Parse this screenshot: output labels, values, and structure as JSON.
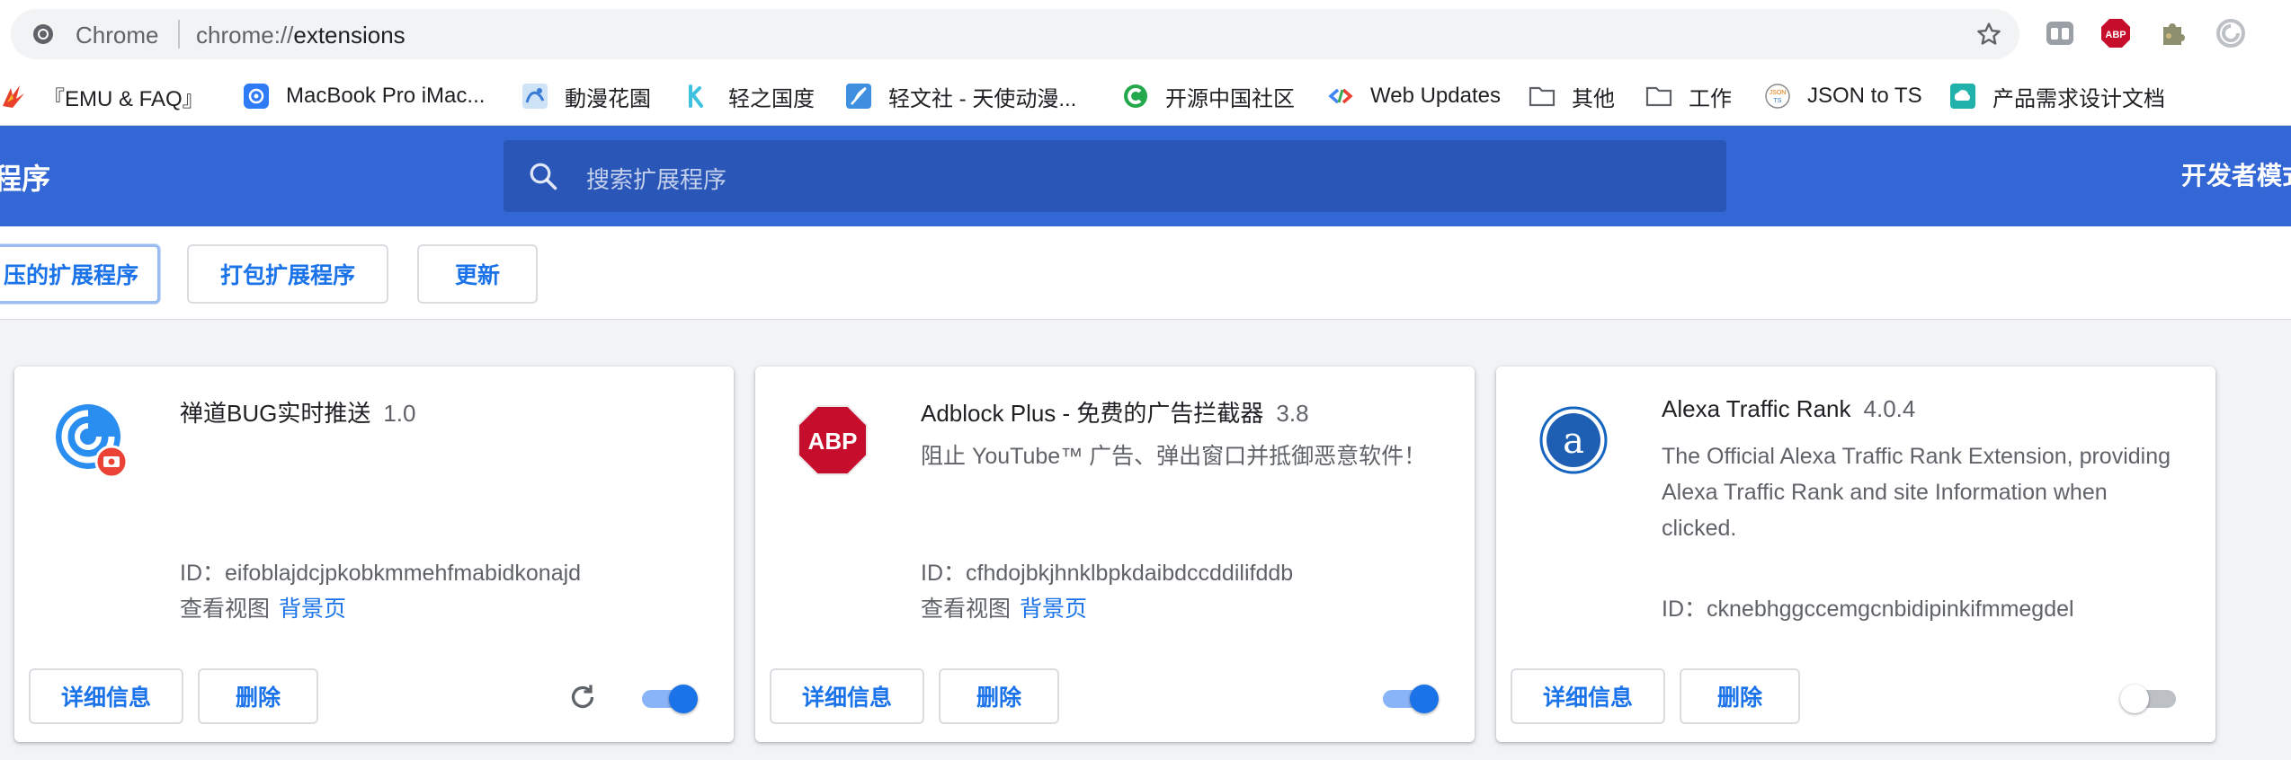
{
  "browser": {
    "omnibox_label": "Chrome",
    "url_scheme": "chrome://",
    "url_path": "extensions"
  },
  "bookmarks": [
    {
      "label": "『EMU & FAQ』",
      "icon": "emu-faq-icon"
    },
    {
      "label": "MacBook Pro iMac...",
      "icon": "macbook-icon"
    },
    {
      "label": "動漫花園",
      "icon": "dmhy-icon"
    },
    {
      "label": "轻之国度",
      "icon": "lightnovel-icon"
    },
    {
      "label": "轻文社 - 天使动漫...",
      "icon": "feather-icon"
    },
    {
      "label": "开源中国社区",
      "icon": "oschina-icon"
    },
    {
      "label": "Web Updates",
      "icon": "web-updates-icon"
    },
    {
      "label": "其他",
      "icon": "folder-icon"
    },
    {
      "label": "工作",
      "icon": "folder-icon"
    },
    {
      "label": "JSON to TS",
      "icon": "json-icon"
    },
    {
      "label": "产品需求设计文档",
      "icon": "cloud-doc-icon"
    }
  ],
  "header": {
    "title": "程序",
    "search_placeholder": "搜索扩展程序",
    "dev_mode_label": "开发者模式"
  },
  "toolbar": {
    "load_unpacked": "压的扩展程序",
    "pack": "打包扩展程序",
    "update": "更新"
  },
  "extensions": [
    {
      "name": "禅道BUG实时推送",
      "version": "1.0",
      "description": "",
      "id_label": "ID：",
      "id": "eifoblajdcjpkobkmmehfmabidkonajd",
      "views_label": "查看视图",
      "views_link": "背景页",
      "details_label": "详细信息",
      "remove_label": "删除",
      "enabled": true,
      "reload": true,
      "icon": "zentao-icon"
    },
    {
      "name": "Adblock Plus - 免费的广告拦截器",
      "version": "3.8",
      "description": "阻止 YouTube™ 广告、弹出窗口并抵御恶意软件！",
      "id_label": "ID：",
      "id": "cfhdojbkjhnklbpkdaibdccddilifddb",
      "views_label": "查看视图",
      "views_link": "背景页",
      "details_label": "详细信息",
      "remove_label": "删除",
      "enabled": true,
      "reload": false,
      "icon": "abp-icon"
    },
    {
      "name": "Alexa Traffic Rank",
      "version": "4.0.4",
      "description": "The Official Alexa Traffic Rank Extension, providing Alexa Traffic Rank and site Information when clicked.",
      "id_label": "ID：",
      "id": "cknebhggccemgcnbidipinkifmmegdel",
      "details_label": "详细信息",
      "remove_label": "删除",
      "enabled": false,
      "reload": false,
      "icon": "alexa-icon"
    }
  ],
  "colors": {
    "header_blue": "#3367d6",
    "accent_blue": "#1a73e8",
    "abp_red": "#c70d2c"
  }
}
